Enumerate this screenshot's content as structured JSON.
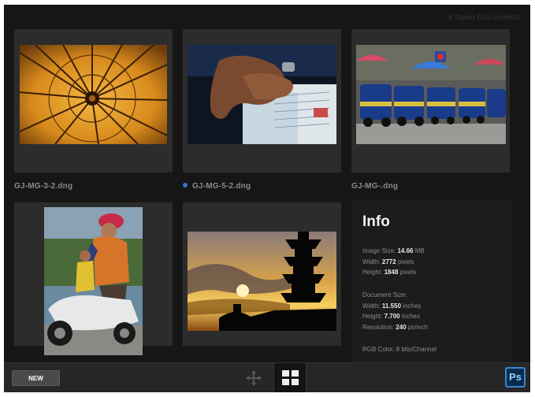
{
  "header": {
    "open_documents": "6 Open Documents"
  },
  "documents": [
    {
      "filename": "GJ-MG-3-2.dng",
      "active": false
    },
    {
      "filename": "GJ-MG-5-2.dng",
      "active": true
    },
    {
      "filename": "GJ-MG-.dng",
      "active": false
    },
    {
      "filename": "",
      "active": false
    },
    {
      "filename": "",
      "active": false
    }
  ],
  "info": {
    "title": "Info",
    "image_size_label": "Image Size:",
    "image_size_value": "14.66",
    "image_size_unit": "MB",
    "width_label": "Width:",
    "width_value": "2772",
    "width_unit": "pixels",
    "height_label": "Height:",
    "height_value": "1848",
    "height_unit": "pixels",
    "document_size_label": "Document Size:",
    "doc_width_label": "Width:",
    "doc_width_value": "11.550",
    "doc_width_unit": "inches",
    "doc_height_label": "Height:",
    "doc_height_value": "7.700",
    "doc_height_unit": "inches",
    "resolution_label": "Resolution:",
    "resolution_value": "240",
    "resolution_unit": "px/inch",
    "color_mode": "RGB Color, 8 bits/Channel"
  },
  "toolbar": {
    "new_label": "NEW",
    "move_icon": "move-arrows-icon",
    "grid_icon": "grid-view-icon",
    "app_icon_label": "Ps"
  },
  "colors": {
    "background": "#161616",
    "card": "#2c2c2c",
    "toolbar": "#262626",
    "active_dot": "#2e78c8",
    "ps_accent": "#3a86d8"
  }
}
